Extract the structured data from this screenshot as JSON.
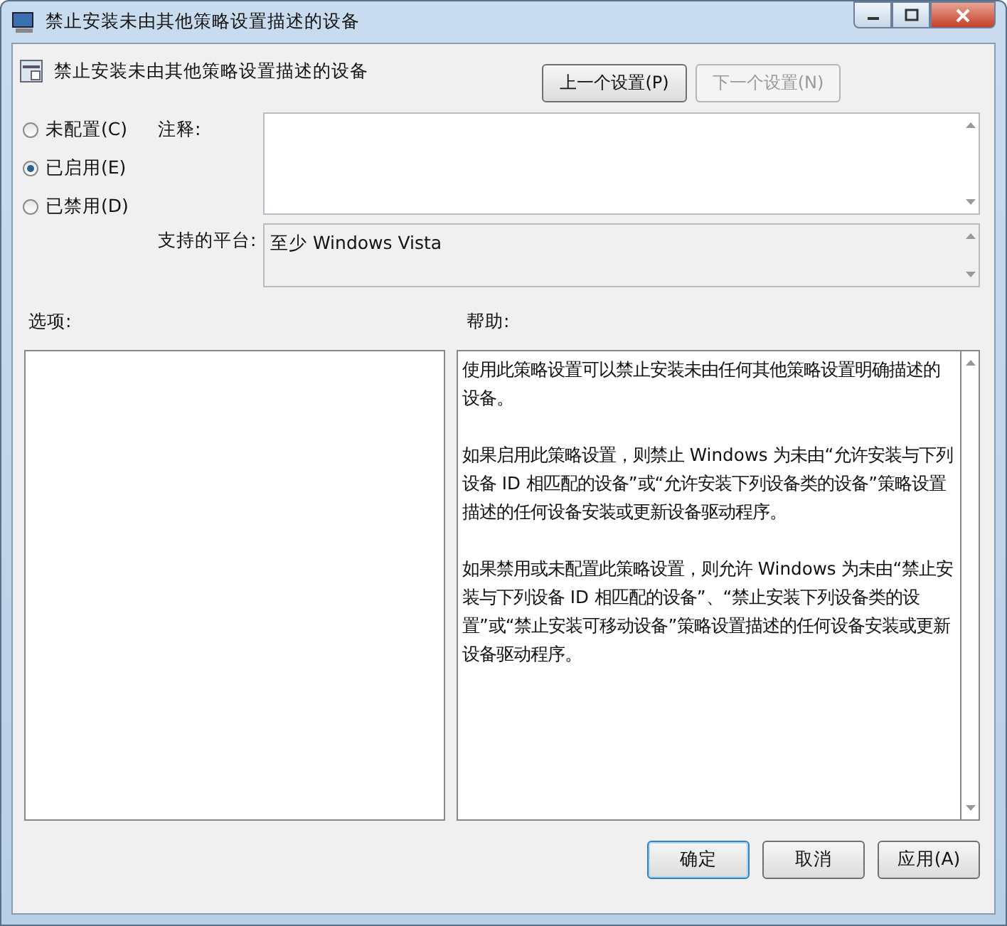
{
  "window": {
    "title": "禁止安装未由其他策略设置描述的设备"
  },
  "header": {
    "title": "禁止安装未由其他策略设置描述的设备",
    "buttons": [
      {
        "label": "上一个设置(P)",
        "disabled": false
      },
      {
        "label": "下一个设置(N)",
        "disabled": true
      }
    ]
  },
  "radios": [
    {
      "label": "未配置(C)",
      "selected": false
    },
    {
      "label": "已启用(E)",
      "selected": true
    },
    {
      "label": "已禁用(D)",
      "selected": false
    }
  ],
  "comment": {
    "label": "注释:"
  },
  "platform": {
    "label": "支持的平台:",
    "value": "至少 Windows Vista"
  },
  "options": {
    "label": "选项:"
  },
  "help": {
    "label": "帮助:",
    "paragraphs": [
      "使用此策略设置可以禁止安装未由任何其他策略设置明确描述的设备。",
      "如果启用此策略设置，则禁止 Windows 为未由“允许安装与下列设备 ID 相匹配的设备”或“允许安装下列设备类的设备”策略设置描述的任何设备安装或更新设备驱动程序。",
      "如果禁用或未配置此策略设置，则允许 Windows 为未由“禁止安装与下列设备 ID 相匹配的设备”、“禁止安装下列设备类的设置”或“禁止安装可移动设备”策略设置描述的任何设备安装或更新设备驱动程序。"
    ]
  },
  "footer_buttons": [
    {
      "label": "确定",
      "kind": "default"
    },
    {
      "label": "取消",
      "kind": "normal"
    },
    {
      "label": "应用(A)",
      "kind": "normal"
    }
  ]
}
